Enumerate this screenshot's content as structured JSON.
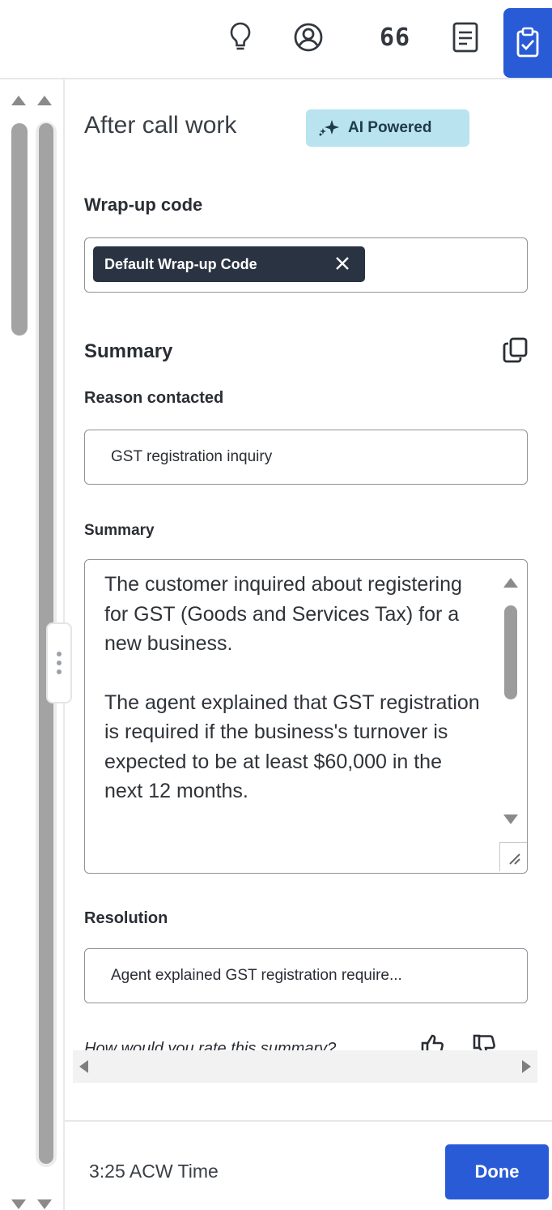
{
  "toolbar": {
    "icons": [
      "lightbulb-icon",
      "user-circle-icon",
      "quote-count",
      "document-icon",
      "clipboard-check-icon"
    ],
    "quote_count": "66",
    "active_color": "#2a5bd7"
  },
  "panel": {
    "title": "After call work",
    "ai_badge": "AI Powered",
    "wrapup": {
      "label": "Wrap-up code",
      "selected": "Default Wrap-up Code"
    },
    "summary_section": {
      "heading": "Summary",
      "reason_label": "Reason contacted",
      "reason_value": "GST registration inquiry",
      "summary_label": "Summary",
      "summary_paragraphs": [
        "The customer inquired about registering for GST (Goods and Services Tax) for a new business.",
        "The agent explained that GST registration is required if the business's turnover is expected to be at least $60,000 in the next 12 months."
      ],
      "resolution_label": "Resolution",
      "resolution_value": "Agent explained GST registration require..."
    },
    "rating": {
      "prompt": "How would you rate this summary?"
    }
  },
  "footer": {
    "acw_time": "3:25 ACW Time",
    "done_label": "Done"
  }
}
